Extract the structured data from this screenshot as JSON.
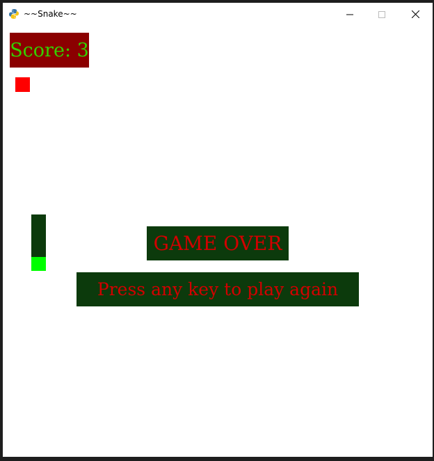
{
  "window": {
    "title": "~~Snake~~",
    "icon": "python-icon",
    "controls": {
      "minimize_icon": "minimize-icon",
      "maximize_icon": "maximize-icon",
      "close_icon": "close-icon"
    }
  },
  "game": {
    "score_text": "Score: 3",
    "score": 3,
    "game_over_text": "GAME OVER",
    "prompt_text": "Press any key to play again",
    "colors": {
      "background": "#ffffff",
      "score_bg": "#8b0000",
      "score_text": "#34d000",
      "banner_bg": "#0c3a0c",
      "banner_text": "#d20000",
      "food": "#ff0000",
      "snake_body": "#0c3a0c",
      "snake_head": "#00ff00"
    }
  }
}
